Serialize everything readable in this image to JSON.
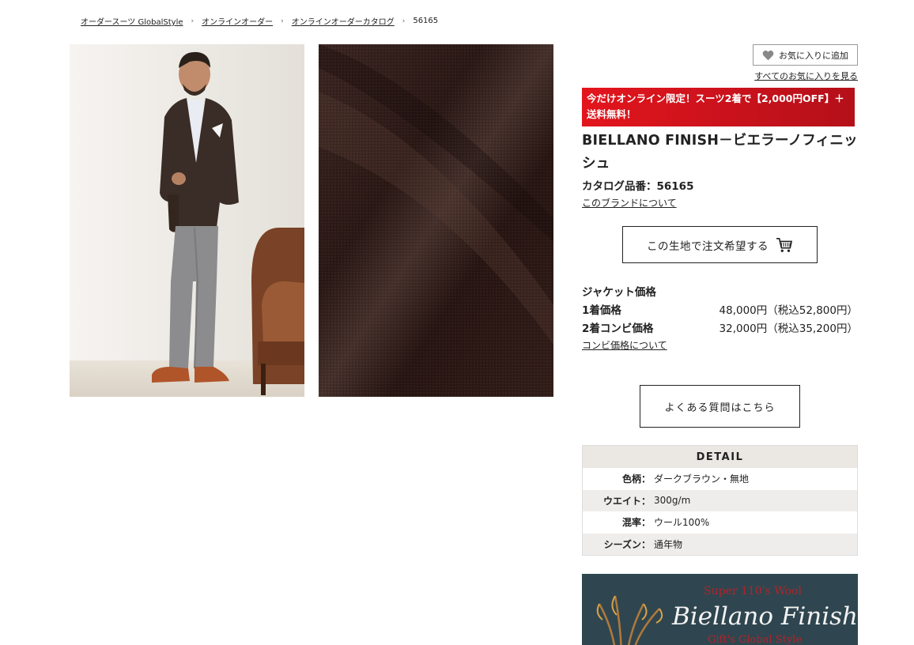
{
  "breadcrumb": {
    "items": [
      "オーダースーツ GlobalStyle",
      "オンラインオーダー",
      "オンラインオーダーカタログ"
    ],
    "current": "56165"
  },
  "favorites": {
    "add_label": "お気に入りに追加",
    "view_all_label": "すべてのお気に入りを見る"
  },
  "promo": {
    "text": "今だけオンライン限定！スーツ2着で【2,000円OFF】＋送料無料！"
  },
  "product": {
    "title": "BIELLANO FINISH－ビエラーノフィニッシュ",
    "catalog_no": "カタログ品番：56165",
    "brand_link": "このブランドについて",
    "order_button": "この生地で注文希望する"
  },
  "pricing": {
    "heading": "ジャケット価格",
    "rows": [
      {
        "label": "1着価格",
        "value": "48,000円（税込52,800円）"
      },
      {
        "label": "2着コンビ価格",
        "value": "32,000円（税込35,200円）"
      }
    ],
    "combo_link": "コンビ価格について"
  },
  "faq_button": "よくある質問はこちら",
  "detail": {
    "heading": "DETAIL",
    "rows": [
      {
        "key": "色柄：",
        "value": "ダークブラウン・無地"
      },
      {
        "key": "ウエイト：",
        "value": "300g/m"
      },
      {
        "key": "混率：",
        "value": "ウール100%"
      },
      {
        "key": "シーズン：",
        "value": "通年物"
      }
    ]
  },
  "banner": {
    "line1": "Super 110's Wool",
    "line2": "Biellano Finish",
    "line3": "Gift's Global Style"
  },
  "icons": {
    "favorite": "heart-icon",
    "cart": "cart-icon",
    "breadcrumb_sep": "chevron-right-icon"
  },
  "colors": {
    "promo_red": "#d2121b",
    "fabric": "#2f1d1a",
    "detail_header": "#ebe7e3",
    "banner_bg": "#2f4650"
  }
}
